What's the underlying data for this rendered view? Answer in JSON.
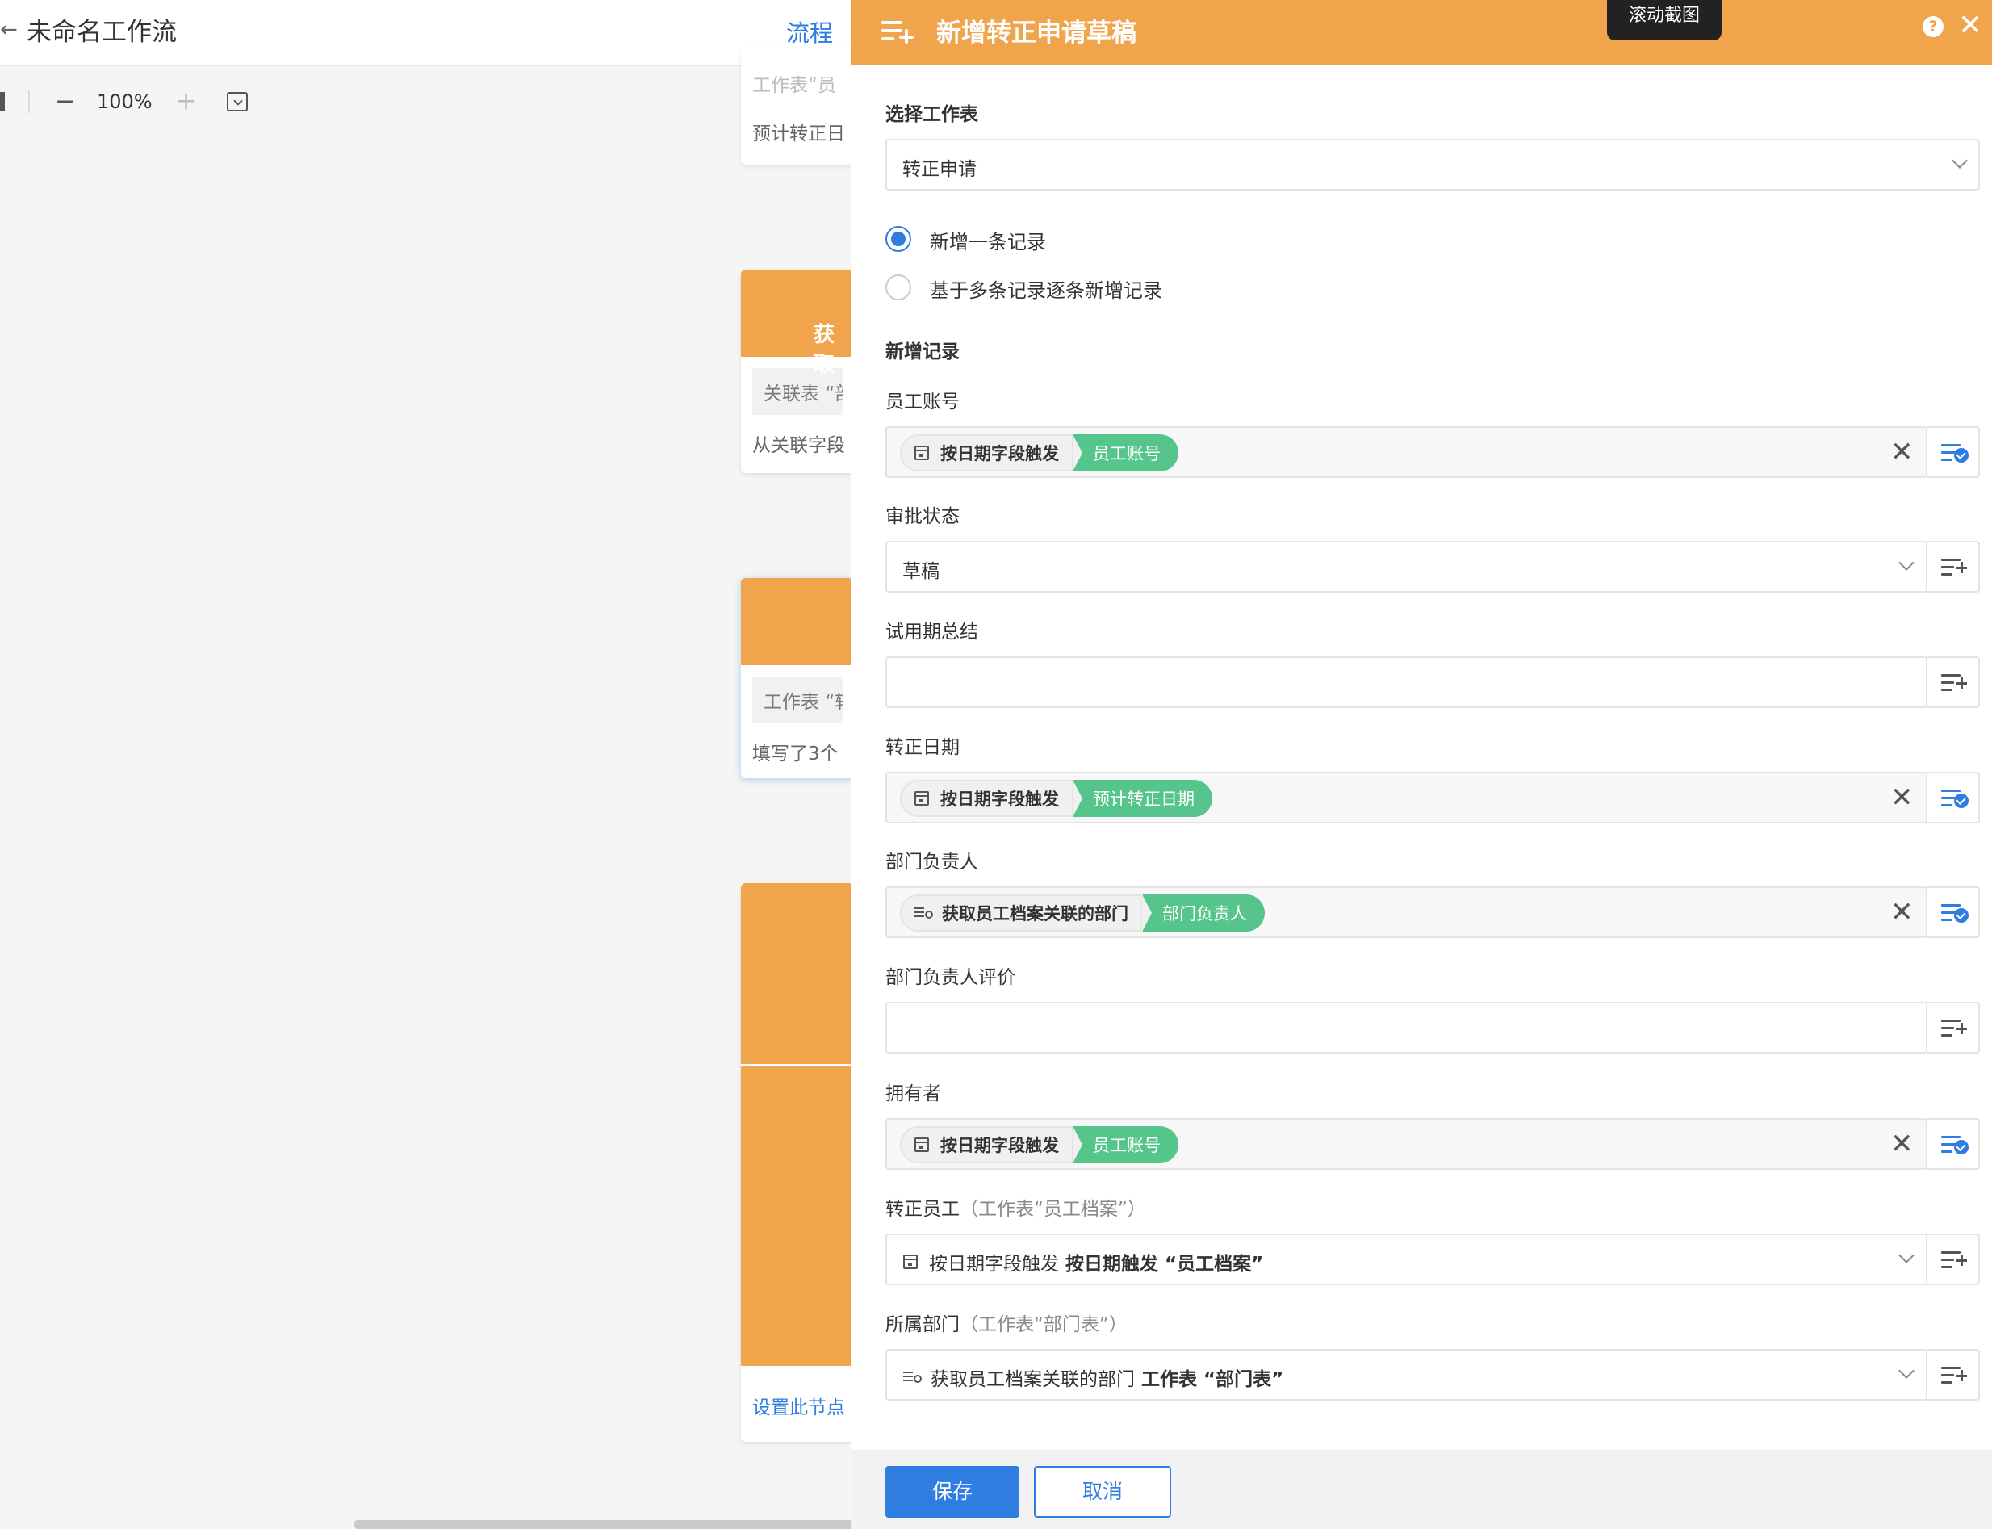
{
  "workflow": {
    "title": "未命名工作流",
    "tab_flow": "流程",
    "zoom": "100%",
    "nodes": [
      {
        "rows": [
          "工作表“员",
          "预计转正日"
        ]
      },
      {
        "title": "获取",
        "rows": [
          "关联表 “部",
          "从关联字段"
        ]
      },
      {
        "rows": [
          "工作表 “转",
          "填写了3个"
        ]
      },
      {
        "link": "设置此节点"
      }
    ]
  },
  "panel": {
    "title": "新增转正申请草稿",
    "tooltip": "滚动截图",
    "select_sheet_label": "选择工作表",
    "select_sheet_value": "转正申请",
    "radio_options": [
      "新增一条记录",
      "基于多条记录逐条新增记录"
    ],
    "section_new_record": "新增记录",
    "fields": {
      "employee_account": {
        "label": "员工账号",
        "src": "按日期字段触发",
        "dst": "员工账号"
      },
      "approval_status": {
        "label": "审批状态",
        "value": "草稿"
      },
      "probation_summary": {
        "label": "试用期总结"
      },
      "confirm_date": {
        "label": "转正日期",
        "src": "按日期字段触发",
        "dst": "预计转正日期"
      },
      "dept_head": {
        "label": "部门负责人",
        "src": "获取员工档案关联的部门",
        "dst": "部门负责人"
      },
      "dept_head_review": {
        "label": "部门负责人评价"
      },
      "owner": {
        "label": "拥有者",
        "src": "按日期字段触发",
        "dst": "员工账号"
      },
      "confirm_employee": {
        "label": "转正员工",
        "sub": "（工作表“员工档案”）",
        "src": "按日期字段触发",
        "ref": "按日期触发 “员工档案”"
      },
      "department": {
        "label": "所属部门",
        "sub": "（工作表“部门表”）",
        "src": "获取员工档案关联的部门",
        "ref": "工作表 “部门表”"
      }
    },
    "save_label": "保存",
    "cancel_label": "取消"
  }
}
